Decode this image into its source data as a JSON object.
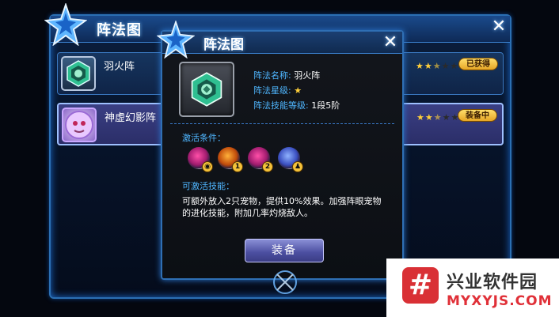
{
  "back_panel": {
    "title": "阵法图",
    "close": "✕",
    "rows": [
      {
        "name": "羽火阵",
        "stars": "★★★☆☆",
        "badge": "已获得",
        "badge_color": "#f2c14a"
      },
      {
        "name": "神虚幻影阵",
        "stars": "★★★☆☆",
        "badge": "装备中",
        "badge_color": "#f2c14a"
      }
    ]
  },
  "popup": {
    "title": "阵法图",
    "close": "✕",
    "info": {
      "name_key": "阵法名称:",
      "name_val": "羽火阵",
      "star_key": "阵法星级:",
      "skill_key": "阵法技能等级:",
      "skill_val": "1段5阶"
    },
    "conditions_label": "激活条件：",
    "conditions": [
      {
        "icon": "eye-orb-icon",
        "badge": ""
      },
      {
        "icon": "fire-orb-icon",
        "badge": "1"
      },
      {
        "icon": "swirl-orb-icon",
        "badge": "2"
      },
      {
        "icon": "person-orb-icon",
        "badge": ""
      }
    ],
    "skills_label": "可激活技能：",
    "skill_desc": "可额外放入2只宠物，提供10%效果。加强阵眼宠物的进化技能，附加几率灼烧敌人。",
    "equip_button": "装备"
  },
  "watermark": {
    "symbol": "#",
    "cn": "兴业软件园",
    "en": "MYXYJS.COM"
  },
  "colors": {
    "accent_blue": "#4fb6ff",
    "panel_border": "#2f6fb4",
    "button": "#5b5fb5",
    "watermark_red": "#d93035"
  }
}
